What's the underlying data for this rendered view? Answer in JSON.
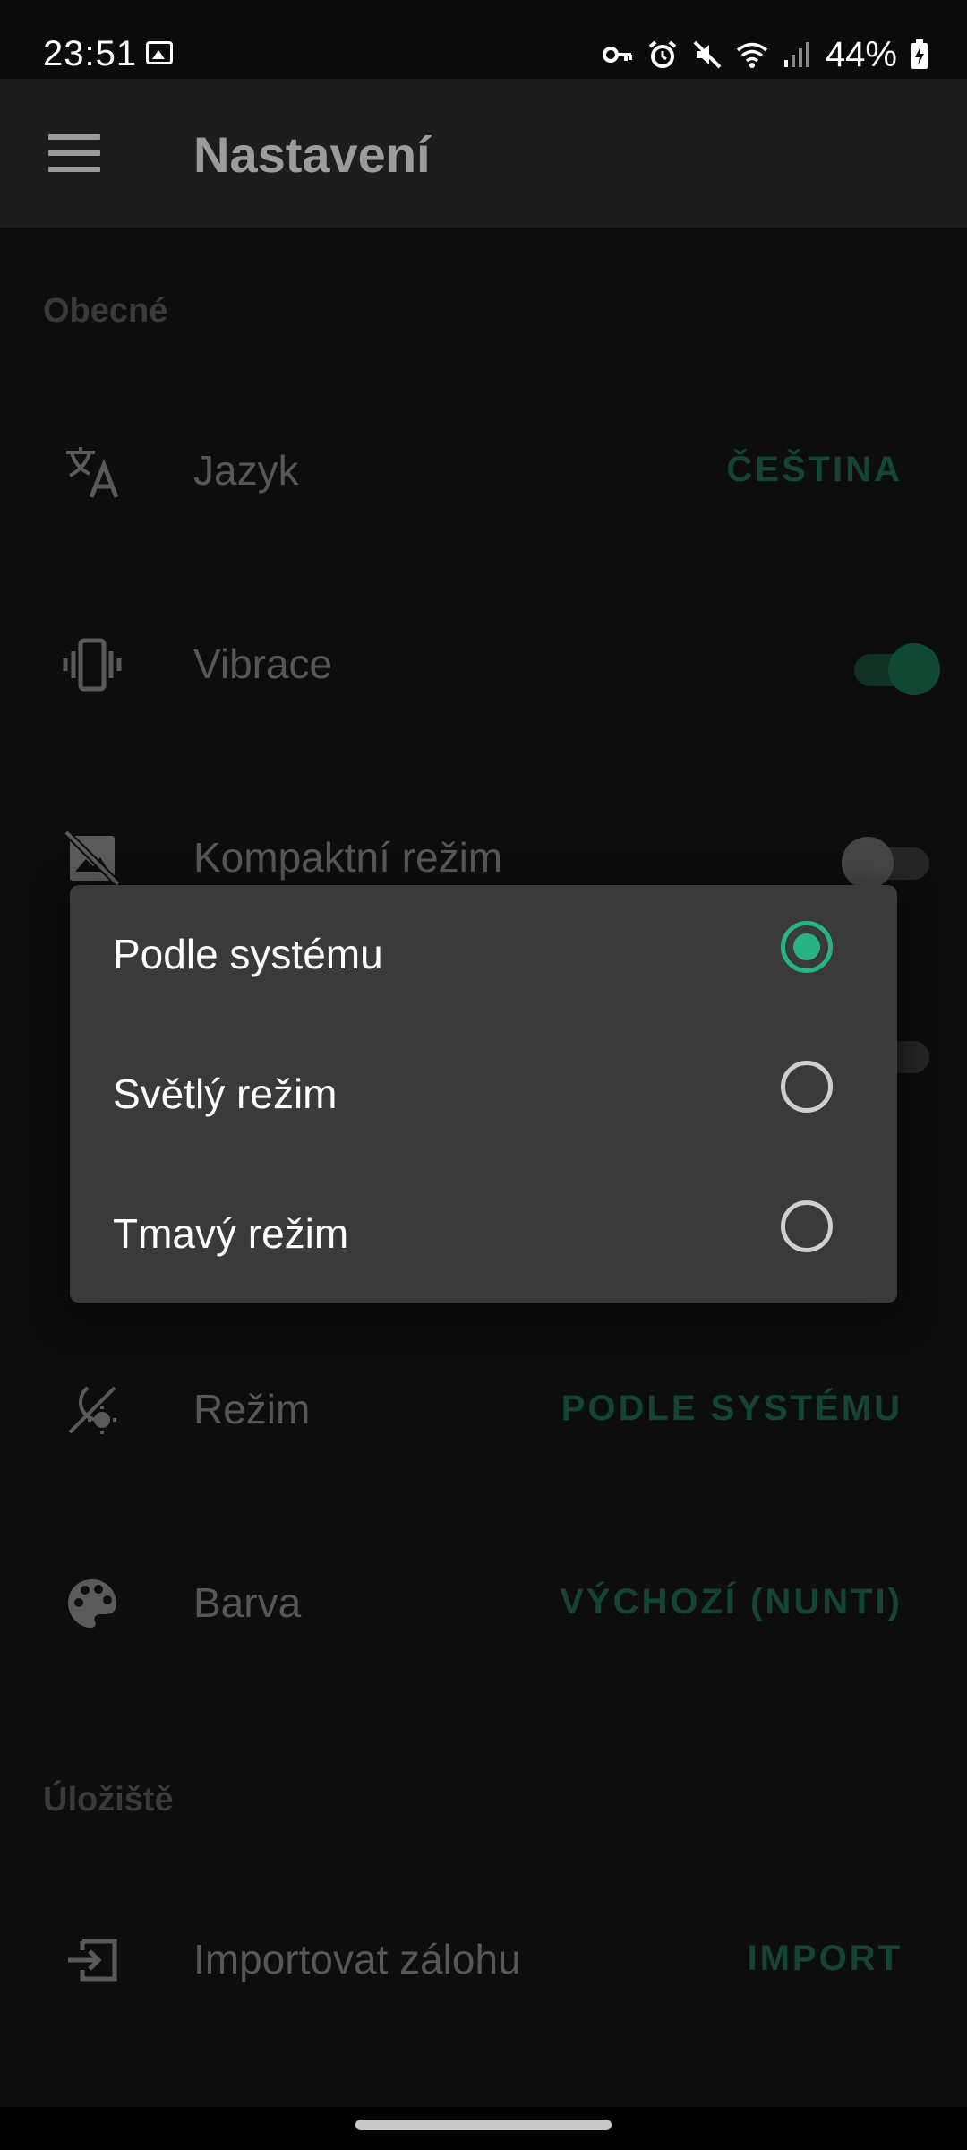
{
  "status": {
    "time": "23:51",
    "battery": "44%",
    "icons": [
      "gallery-icon",
      "vpn-key-icon",
      "alarm-icon",
      "mute-icon",
      "wifi-icon",
      "signal-icon",
      "battery-charging-icon"
    ]
  },
  "appbar": {
    "title": "Nastavení",
    "menu_icon": "menu-icon"
  },
  "general": {
    "header": "Obecné",
    "language": {
      "label": "Jazyk",
      "value": "ČEŠTINA",
      "icon": "translate-icon"
    },
    "vibration": {
      "label": "Vibrace",
      "on": true,
      "icon": "vibration-icon"
    },
    "compact": {
      "label": "Kompaktní režim",
      "on": false,
      "icon": "image-off-icon"
    }
  },
  "appearance": {
    "mode": {
      "label": "Režim",
      "value": "PODLE SYSTÉMU",
      "icon": "theme-mode-icon"
    },
    "color": {
      "label": "Barva",
      "value": "VÝCHOZÍ (NUNTI)",
      "icon": "palette-icon"
    }
  },
  "storage": {
    "header": "Úložiště",
    "import": {
      "label": "Importovat zálohu",
      "value": "IMPORT",
      "icon": "import-icon"
    }
  },
  "dialog": {
    "options": [
      {
        "label": "Podle systému",
        "selected": true
      },
      {
        "label": "Světlý režim",
        "selected": false
      },
      {
        "label": "Tmavý režim",
        "selected": false
      }
    ]
  },
  "colors": {
    "accent": "#27b482",
    "accent_dim": "#1c6a4d",
    "background": "#141414",
    "dialog": "#3a3a3a"
  }
}
